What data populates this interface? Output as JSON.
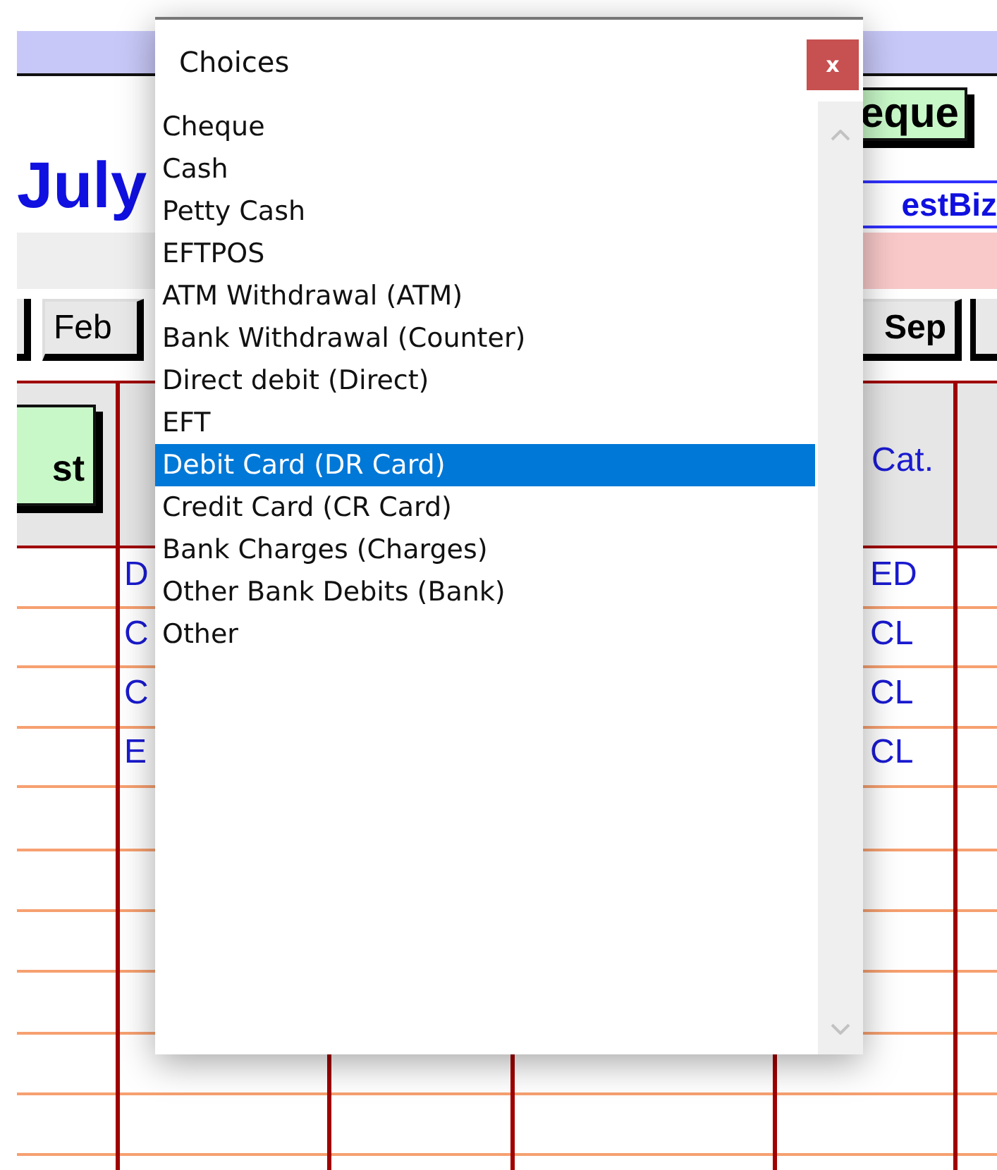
{
  "sheet": {
    "title": "July",
    "left_button": {
      "label": "st"
    },
    "right_button": {
      "label": "eque"
    },
    "business_name": "estBiz",
    "left_month_tab": {
      "label": "Feb"
    },
    "right_month_tab": {
      "label": "Sep"
    },
    "category_header": "Cat.",
    "rows": [
      {
        "column_1": "D",
        "column_2": "ED"
      },
      {
        "column_1": "C",
        "column_2": "CL"
      },
      {
        "column_1": "C",
        "column_2": "CL"
      },
      {
        "column_1": "E",
        "column_2": "CL"
      }
    ]
  },
  "dialog": {
    "title": "Choices",
    "close": "x",
    "items": [
      {
        "label": "Cheque",
        "selected": false
      },
      {
        "label": "Cash",
        "selected": false
      },
      {
        "label": "Petty Cash",
        "selected": false
      },
      {
        "label": "EFTPOS",
        "selected": false
      },
      {
        "label": "ATM Withdrawal (ATM)",
        "selected": false
      },
      {
        "label": "Bank Withdrawal (Counter)",
        "selected": false
      },
      {
        "label": "Direct debit (Direct)",
        "selected": false
      },
      {
        "label": "EFT",
        "selected": false
      },
      {
        "label": "Debit Card (DR Card)",
        "selected": true
      },
      {
        "label": "Credit Card (CR Card)",
        "selected": false
      },
      {
        "label": "Bank Charges (Charges)",
        "selected": false
      },
      {
        "label": "Other Bank Debits (Bank)",
        "selected": false
      },
      {
        "label": "Other",
        "selected": false
      }
    ]
  }
}
